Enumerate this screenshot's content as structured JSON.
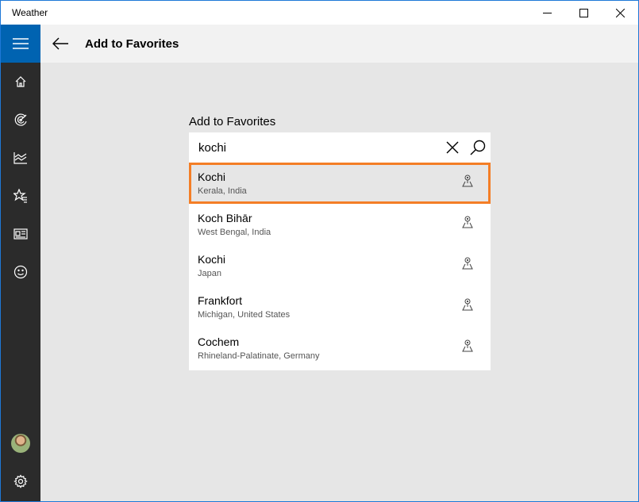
{
  "window": {
    "title": "Weather"
  },
  "header": {
    "title": "Add to Favorites"
  },
  "sidebar": {
    "items": [
      {
        "name": "home-icon"
      },
      {
        "name": "radar-icon"
      },
      {
        "name": "chart-icon"
      },
      {
        "name": "favorites-icon"
      },
      {
        "name": "news-icon"
      },
      {
        "name": "feedback-icon"
      }
    ]
  },
  "favorites": {
    "label": "Add to Favorites",
    "search_value": "kochi",
    "results": [
      {
        "city": "Kochi",
        "region": "Kerala, India",
        "selected": true
      },
      {
        "city": "Koch Bihār",
        "region": "West Bengal, India",
        "selected": false
      },
      {
        "city": "Kochi",
        "region": "Japan",
        "selected": false
      },
      {
        "city": "Frankfort",
        "region": "Michigan, United States",
        "selected": false
      },
      {
        "city": "Cochem",
        "region": "Rhineland-Palatinate, Germany",
        "selected": false
      }
    ]
  },
  "colors": {
    "accent": "#0063b1",
    "highlight": "#f47e26",
    "sidebar": "#2b2b2b"
  }
}
